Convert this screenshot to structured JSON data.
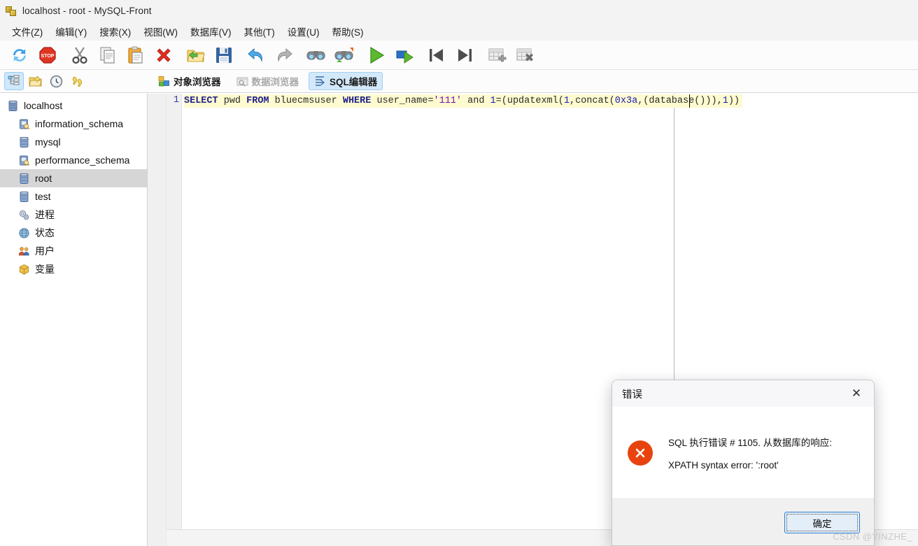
{
  "window": {
    "title": "localhost - root - MySQL-Front",
    "app_icon": "mysql-front-logo-icon"
  },
  "menubar": {
    "items": [
      {
        "label": "文件(Z)",
        "name": "menu-file"
      },
      {
        "label": "编辑(Y)",
        "name": "menu-edit"
      },
      {
        "label": "搜索(X)",
        "name": "menu-search"
      },
      {
        "label": "视图(W)",
        "name": "menu-view"
      },
      {
        "label": "数据库(V)",
        "name": "menu-database"
      },
      {
        "label": "其他(T)",
        "name": "menu-other"
      },
      {
        "label": "设置(U)",
        "name": "menu-settings"
      },
      {
        "label": "帮助(S)",
        "name": "menu-help"
      }
    ]
  },
  "toolbar": {
    "buttons": [
      {
        "icon": "refresh-icon"
      },
      {
        "icon": "stop-icon"
      },
      {
        "icon": "cut-icon"
      },
      {
        "icon": "copy-icon"
      },
      {
        "icon": "paste-icon"
      },
      {
        "icon": "delete-icon"
      },
      {
        "icon": "open-folder-icon"
      },
      {
        "icon": "save-icon"
      },
      {
        "icon": "undo-icon"
      },
      {
        "icon": "redo-icon"
      },
      {
        "icon": "find-icon"
      },
      {
        "icon": "find-replace-icon"
      },
      {
        "icon": "execute-icon"
      },
      {
        "icon": "execute-step-icon"
      },
      {
        "icon": "first-record-icon"
      },
      {
        "icon": "last-record-icon"
      },
      {
        "icon": "add-table-icon"
      },
      {
        "icon": "drop-table-icon"
      }
    ]
  },
  "subbar": {
    "left_buttons": [
      {
        "icon": "tree-view-icon",
        "selected": true
      },
      {
        "icon": "folder-icon",
        "selected": false
      },
      {
        "icon": "history-clock-icon",
        "selected": false
      },
      {
        "icon": "footprints-icon",
        "selected": false
      }
    ],
    "tabs": [
      {
        "label": "对象浏览器",
        "icon": "object-browser-icon",
        "state": "normal",
        "name": "tab-object-browser"
      },
      {
        "label": "数据浏览器",
        "icon": "data-browser-icon",
        "state": "disabled",
        "name": "tab-data-browser"
      },
      {
        "label": "SQL编辑器",
        "icon": "sql-editor-icon",
        "state": "active",
        "name": "tab-sql-editor"
      }
    ]
  },
  "sidebar": {
    "items": [
      {
        "label": "localhost",
        "icon": "server-icon",
        "level": 0,
        "selected": false,
        "name": "tree-item-localhost"
      },
      {
        "label": "information_schema",
        "icon": "schema-icon",
        "level": 1,
        "selected": false,
        "name": "tree-item-information-schema"
      },
      {
        "label": "mysql",
        "icon": "database-icon",
        "level": 1,
        "selected": false,
        "name": "tree-item-mysql"
      },
      {
        "label": "performance_schema",
        "icon": "schema-icon",
        "level": 1,
        "selected": false,
        "name": "tree-item-performance-schema"
      },
      {
        "label": "root",
        "icon": "database-icon",
        "level": 1,
        "selected": true,
        "name": "tree-item-root"
      },
      {
        "label": "test",
        "icon": "database-icon",
        "level": 1,
        "selected": false,
        "name": "tree-item-test"
      },
      {
        "label": "进程",
        "icon": "process-gear-icon",
        "level": 1,
        "selected": false,
        "name": "tree-item-processes"
      },
      {
        "label": "状态",
        "icon": "globe-status-icon",
        "level": 1,
        "selected": false,
        "name": "tree-item-status"
      },
      {
        "label": "用户",
        "icon": "users-icon",
        "level": 1,
        "selected": false,
        "name": "tree-item-users"
      },
      {
        "label": "变量",
        "icon": "package-icon",
        "level": 1,
        "selected": false,
        "name": "tree-item-variables"
      }
    ]
  },
  "editor": {
    "line_number": "1",
    "sql_full": "SELECT pwd FROM bluecmsuser WHERE user_name='111' and 1=(updatexml(1,concat(0x3a,(database())),1))",
    "tokens": [
      {
        "t": "SELECT",
        "c": "kw"
      },
      {
        "t": " pwd ",
        "c": "ident"
      },
      {
        "t": "FROM",
        "c": "kw"
      },
      {
        "t": " bluecmsuser ",
        "c": "ident"
      },
      {
        "t": "WHERE",
        "c": "kw"
      },
      {
        "t": " user_name=",
        "c": "ident"
      },
      {
        "t": "'111'",
        "c": "str"
      },
      {
        "t": " and ",
        "c": "ident"
      },
      {
        "t": "1",
        "c": "num"
      },
      {
        "t": "=(updatexml(",
        "c": "punct"
      },
      {
        "t": "1",
        "c": "num"
      },
      {
        "t": ",concat(",
        "c": "punct"
      },
      {
        "t": "0x3a",
        "c": "num"
      },
      {
        "t": ",(database())),",
        "c": "punct"
      },
      {
        "t": "1",
        "c": "num"
      },
      {
        "t": "))",
        "c": "punct"
      }
    ]
  },
  "dialog": {
    "title": "错误",
    "close_icon": "close-icon",
    "error_icon": "error-circle-icon",
    "message_line1": "SQL 执行错误 # 1105. 从数据库的响应:",
    "message_line2": "XPATH syntax error: ':root'",
    "ok_label": "确定"
  },
  "watermark": {
    "text": "CSDN @YINZHE_"
  },
  "colors": {
    "accent_blue": "#2a7fd4",
    "error_red": "#e8430e",
    "selection_gray": "#d6d6d6",
    "code_highlight": "#fdfbcf",
    "tab_active_bg": "#d3e9fb"
  }
}
